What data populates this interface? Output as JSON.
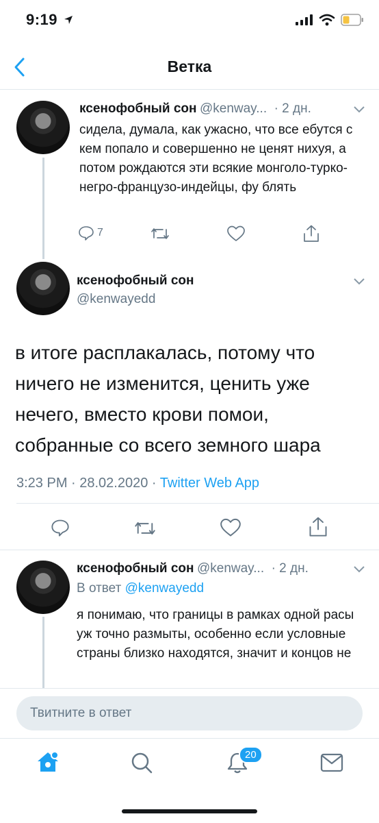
{
  "status": {
    "time": "9:19"
  },
  "header": {
    "title": "Ветка"
  },
  "tweets": [
    {
      "name": "ксенофобный сон",
      "handle": "@kenway...",
      "time": "· 2 дн.",
      "text": "сидела, думала, как ужасно, что все ебутся с кем попало и совершенно не ценят нихуя, а потом рождаются эти всякие монголо-турко-негро-французо-индейцы, фу блять",
      "reply_count": "7"
    },
    {
      "name": "ксенофобный сон",
      "handle": "@kenwayedd",
      "text": "в итоге расплакалась, потому что ничего не изменится, ценить уже нечего, вместо крови помои, собранные со всего земного шара",
      "timestamp": "3:23 PM · 28.02.2020 ·",
      "source": "Twitter Web App"
    },
    {
      "name": "ксенофобный сон",
      "handle": "@kenway...",
      "time": "· 2 дн.",
      "reply_prefix": "В ответ",
      "reply_to": "@kenwayedd",
      "text": "я понимаю, что границы в рамках одной расы уж точно размыты, особенно если условные страны близко находятся, значит и концов не"
    }
  ],
  "compose": {
    "placeholder": "Твитните в ответ"
  },
  "tabbar": {
    "notifications_badge": "20"
  },
  "colors": {
    "accent": "#1da1f2",
    "secondary_text": "#657786",
    "divider": "#e1e8ed"
  }
}
